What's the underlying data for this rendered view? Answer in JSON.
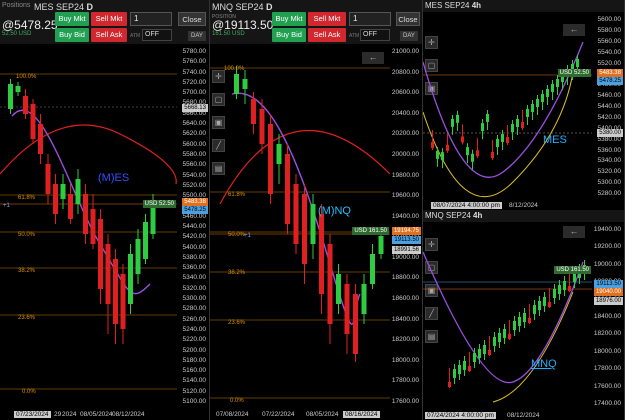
{
  "panel1": {
    "tab": "Positions",
    "title": "MES SEP24",
    "tf": "D",
    "price": "@5478.25",
    "sub": "52.50 USD",
    "buy_mkt": "Buy Mkt",
    "sell_mkt": "Sell Mkt",
    "buy_bid": "Buy Bid",
    "sell_ask": "Sell Ask",
    "qty": "1",
    "close": "Close",
    "atm": "ATM",
    "off": "OFF",
    "day": "DAY",
    "y_labels": [
      "5780.00",
      "5760.00",
      "5740.00",
      "5720.00",
      "5700.00",
      "5680.00",
      "5660.00",
      "5640.00",
      "5620.00",
      "5600.00",
      "5580.00",
      "5560.00",
      "5540.00",
      "5520.00",
      "5500.00",
      "5480.00",
      "5460.00",
      "5440.00",
      "5420.00",
      "5400.00",
      "5380.00",
      "5360.00",
      "5340.00",
      "5320.00",
      "5300.00",
      "5280.00",
      "5260.00",
      "5240.00",
      "5220.00",
      "5200.00",
      "5180.00",
      "5160.00",
      "5140.00",
      "5120.00",
      "5100.00"
    ],
    "x_labels": [
      "07/23/2024",
      "29",
      "2024",
      "08/05/2024",
      "08/12/2024"
    ],
    "fibs": [
      "100.0%",
      "61.8%",
      "50.0%",
      "38.2%",
      "23.6%",
      "0.0%"
    ],
    "annotation": "(M)ES",
    "tag_top": "5668.13",
    "tag_mid": "5483.38",
    "tag_price": "5478.25",
    "tag_usd": "USD 52.50",
    "plus1": "+1",
    "colors": {
      "up": "#2ecc40",
      "down": "#e02020",
      "ema": "#9b4fe0",
      "arc": "#e02020"
    }
  },
  "panel2": {
    "title": "MNQ SEP24",
    "tf": "D",
    "tab": "POSITION",
    "price": "@19113.50",
    "sub": "161.50 USD",
    "buy_mkt": "Buy Mkt",
    "sell_mkt": "Sell Mkt",
    "buy_bid": "Buy Bid",
    "sell_ask": "Sell Ask",
    "qty": "1",
    "close": "Close",
    "atm": "ATM",
    "off": "OFF",
    "day": "DAY",
    "y_labels": [
      "21000.00",
      "20800.00",
      "20600.00",
      "20400.00",
      "20200.00",
      "20000.00",
      "19800.00",
      "19600.00",
      "19400.00",
      "19200.00",
      "19000.00",
      "18800.00",
      "18600.00",
      "18400.00",
      "18200.00",
      "18000.00",
      "17800.00",
      "17600.00"
    ],
    "x_labels": [
      "07/08/2024",
      "07/22/2024",
      "08/05/2024",
      "08/16/2024"
    ],
    "fibs": [
      "100.0%",
      "61.8%",
      "50.0%",
      "38.2%",
      "23.6%",
      "0.0%"
    ],
    "annotation": "(M)NQ",
    "tag_usd": "USD 161.50",
    "tag_price": "19194.75",
    "tag_mid": "19113.50",
    "tag_low": "18991.56",
    "plus1": "+1"
  },
  "panel3": {
    "title": "MES SEP24",
    "tf": "4h",
    "y_labels": [
      "5600.00",
      "5580.00",
      "5560.00",
      "5540.00",
      "5520.00",
      "5500.00",
      "5480.00",
      "5460.00",
      "5440.00",
      "5420.00",
      "5400.00",
      "5380.00",
      "5360.00",
      "5340.00",
      "5320.00",
      "5300.00",
      "5280.00"
    ],
    "x_labels": [
      "08/07/2024 4:00:00 pm",
      "8/12/2024"
    ],
    "annotation": "MES",
    "tag_usd": "USD 52.50",
    "tag_price": "5478.25",
    "tag_a": "5483.38",
    "tag_b": "5380.00"
  },
  "panel4": {
    "title": "MNQ SEP24",
    "tf": "4h",
    "y_labels": [
      "19400.00",
      "19200.00",
      "19000.00",
      "18800.00",
      "18600.00",
      "18400.00",
      "18200.00",
      "18000.00",
      "17800.00",
      "17600.00",
      "17400.00"
    ],
    "x_labels": [
      "07/24/2024 4:00:00 pm",
      "08/12/2024"
    ],
    "annotation": "MNQ",
    "tag_usd": "USD 161.50",
    "tag_price": "19113.50",
    "tag_a": "19040.00",
    "tag_b": "18976.00"
  }
}
